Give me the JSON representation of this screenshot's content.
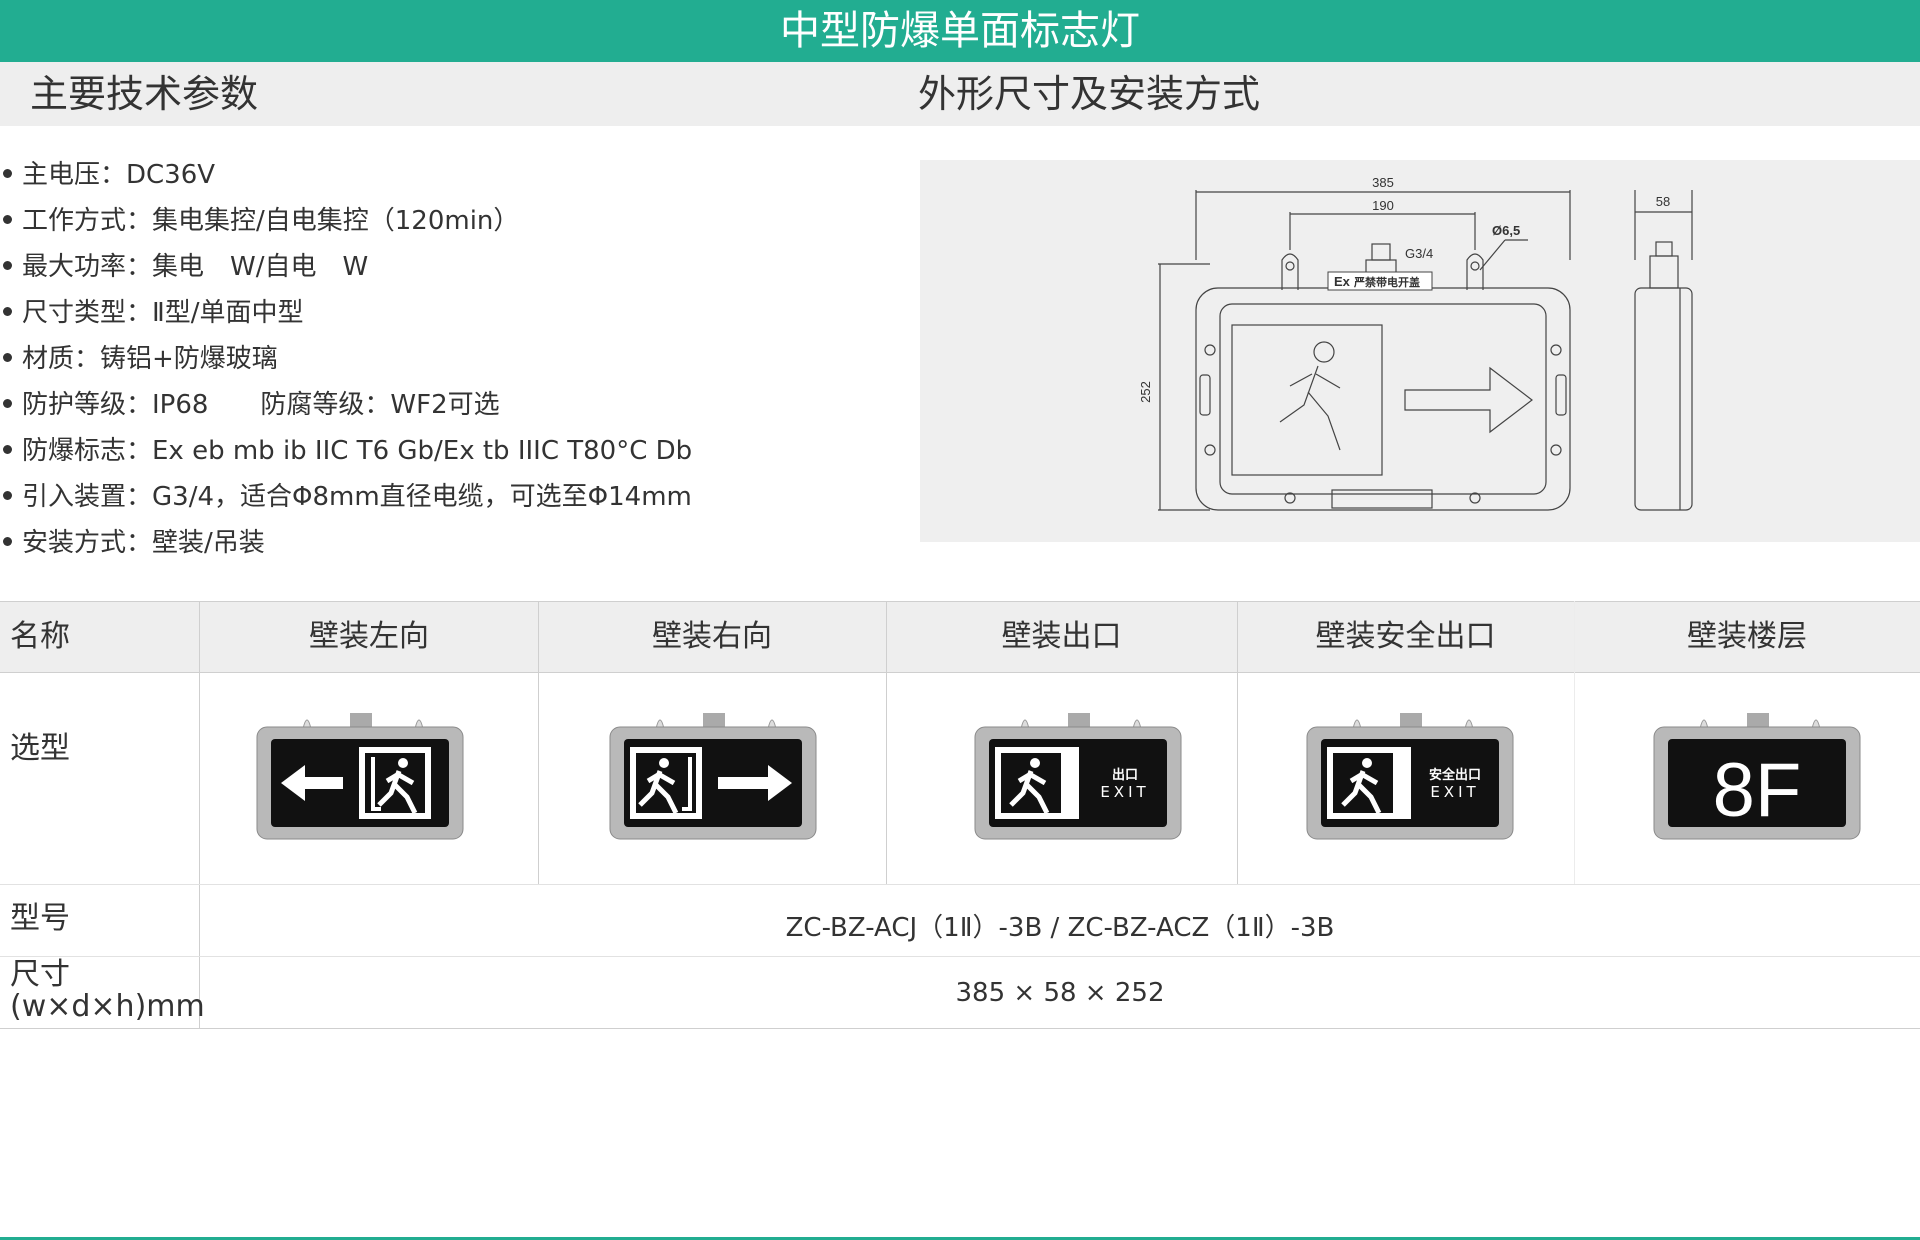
{
  "header": {
    "title": "中型防爆单面标志灯",
    "left_heading": "主要技术参数",
    "right_heading": "外形尺寸及安装方式"
  },
  "params": [
    "主电压：DC36V",
    "工作方式：集电集控/自电集控（120min）",
    "最大功率：集电　W/自电　W",
    "尺寸类型：Ⅱ型/单面中型",
    "材质：铸铝+防爆玻璃",
    "防护等级：IP68　　防腐等级：WF2可选",
    "防爆标志：Ex eb mb ib IIC T6 Gb/Ex tb IIIC T80°C Db",
    "引入装置：G3/4，适合Φ8mm直径电缆，可选至Φ14mm",
    "安装方式：壁装/吊装"
  ],
  "diagram": {
    "dim_overall_width": "385",
    "dim_mount_spacing": "190",
    "dim_height": "252",
    "dim_depth": "58",
    "thread_label": "G3/4",
    "hole_label": "Ø6,5",
    "ex_mark": "Ex",
    "ex_text": "严禁带电开盖"
  },
  "table": {
    "col_header": "名称",
    "columns": [
      "壁装左向",
      "壁装右向",
      "壁装出口",
      "壁装安全出口",
      "壁装楼层"
    ],
    "row_selection": "选型",
    "row_model": "型号",
    "model_value": "ZC-BZ-ACJ（1Ⅱ）-3B / ZC-BZ-ACZ（1Ⅱ）-3B",
    "row_size_line1": "尺寸",
    "row_size_line2": "(w×d×h)mm",
    "size_value": "385 × 58 × 252"
  },
  "lamps": {
    "exit_cn": "出口",
    "exit_en": "EXIT",
    "safe_exit_cn": "安全出口",
    "floor_label": "8F"
  },
  "colors": {
    "accent": "#22ad91",
    "panel": "#eeeeee"
  }
}
